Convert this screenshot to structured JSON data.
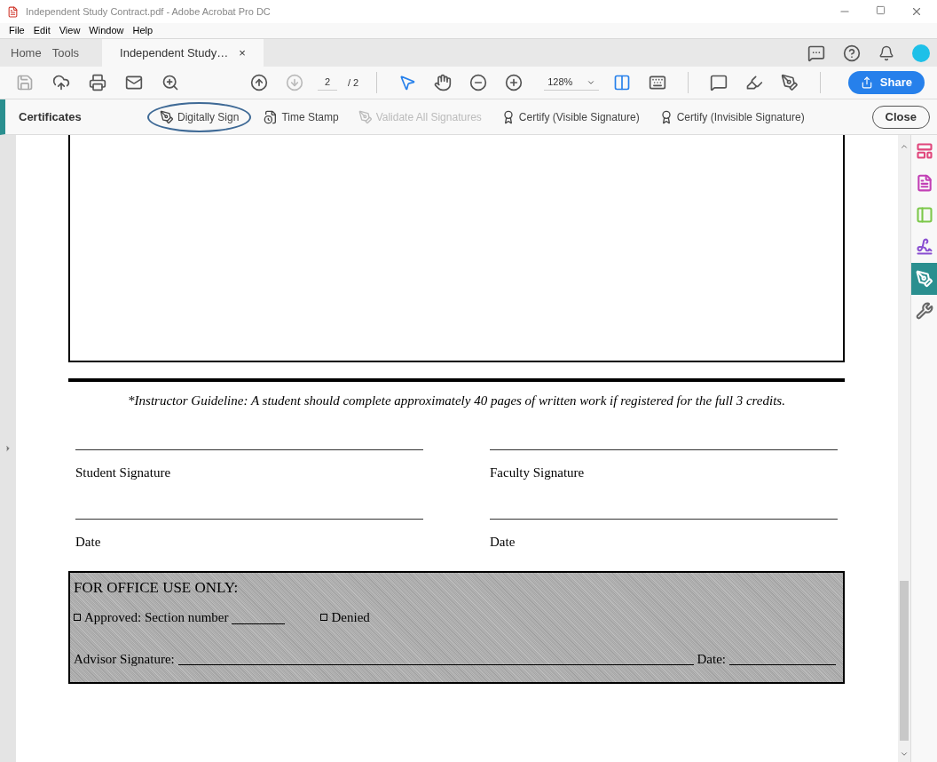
{
  "window": {
    "title": "Independent Study Contract.pdf - Adobe Acrobat Pro DC"
  },
  "menu": [
    "File",
    "Edit",
    "View",
    "Window",
    "Help"
  ],
  "tabs": [
    {
      "label": "Home",
      "selected": false
    },
    {
      "label": "Tools",
      "selected": false
    },
    {
      "label": "Independent Study…",
      "selected": true,
      "close": "×"
    }
  ],
  "toolbar": {
    "page_current": "2",
    "page_total": "/ 2",
    "zoom": "128%",
    "share": "Share"
  },
  "certificates": {
    "title": "Certificates",
    "close": "Close",
    "actions": [
      {
        "label": "Digitally Sign",
        "disabled": false,
        "circled": true
      },
      {
        "label": "Time Stamp",
        "disabled": false,
        "circled": false
      },
      {
        "label": "Validate All Signatures",
        "disabled": true,
        "circled": false
      },
      {
        "label": "Certify (Visible Signature)",
        "disabled": false,
        "circled": false
      },
      {
        "label": "Certify (Invisible Signature)",
        "disabled": false,
        "circled": false
      }
    ]
  },
  "document": {
    "guideline": "*Instructor Guideline: A student should complete approximately 40 pages of written work if registered for the full 3 credits.",
    "signatures": [
      {
        "label": "Student Signature"
      },
      {
        "label": "Faculty Signature"
      },
      {
        "label": "Date"
      },
      {
        "label": "Date"
      }
    ],
    "office": {
      "heading": "FOR OFFICE USE ONLY:",
      "approved": "Approved: Section number",
      "approved_checked": false,
      "denied": "Denied",
      "denied_checked": false,
      "advisor": "Advisor Signature:",
      "date": "Date:"
    }
  },
  "right_panel": [
    {
      "color": "#e0457b",
      "selected": false
    },
    {
      "color": "#c23fb5",
      "selected": false
    },
    {
      "color": "#7cc84a",
      "selected": false
    },
    {
      "color": "#8a4fd1",
      "selected": false
    },
    {
      "color": "#2a8f8f",
      "selected": true
    },
    {
      "color": "#666666",
      "selected": false
    }
  ]
}
